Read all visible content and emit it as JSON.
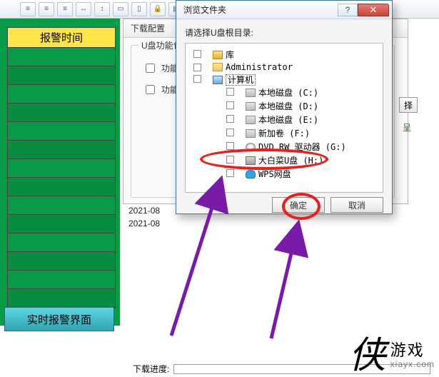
{
  "toolbar_icons": [
    "align-left-icon",
    "align-center-icon",
    "align-right-icon",
    "distribute-h-icon",
    "distribute-v-icon",
    "group-icon",
    "ungroup-icon",
    "lock-icon",
    "front-icon",
    "back-icon",
    "grid-icon"
  ],
  "left_panel": {
    "header": "报警时间",
    "rows": 14,
    "button": "实时报警界面"
  },
  "config": {
    "title": "下载配置",
    "group_label": "U盘功能包",
    "rows": [
      {
        "label": "功能包"
      },
      {
        "label": "功能包"
      }
    ]
  },
  "side": {
    "select_btn": "择",
    "progress_mark": "呈"
  },
  "timestamps": [
    "2021-08",
    "2021-08"
  ],
  "dl_progress_label": "下载进度:",
  "dialog": {
    "title": "浏览文件夹",
    "instruction": "请选择U盘根目录:",
    "ok": "确定",
    "cancel": "取消",
    "tree": {
      "top": [
        {
          "label": "库",
          "icon": "ico-lib"
        },
        {
          "label": "Administrator",
          "icon": "ico-fold"
        }
      ],
      "computer_label": "计算机",
      "drives": [
        {
          "label": "本地磁盘 (C:)",
          "icon": "ico-hdd"
        },
        {
          "label": "本地磁盘 (D:)",
          "icon": "ico-hdd"
        },
        {
          "label": "本地磁盘 (E:)",
          "icon": "ico-hdd"
        },
        {
          "label": "新加卷 (F:)",
          "icon": "ico-hdd"
        },
        {
          "label": "DVD RW 驱动器 (G:)",
          "icon": "ico-dvd"
        },
        {
          "label": "大白菜U盘 (H:)",
          "icon": "ico-usb"
        },
        {
          "label": "WPS网盘",
          "icon": "ico-cloud"
        }
      ]
    }
  },
  "logo": {
    "cn": "游戏",
    "en": "xiayx.com",
    "glyph": "侠"
  }
}
